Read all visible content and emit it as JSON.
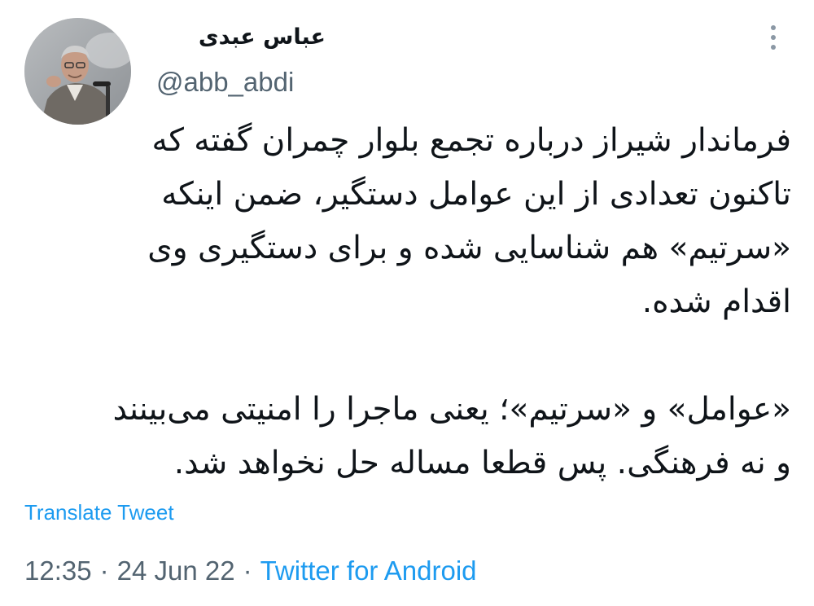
{
  "author": {
    "display_name": "عباس عبدی",
    "handle": "@abb_abdi"
  },
  "tweet": {
    "paragraph1": [
      "فرماندار شیراز درباره تجمع بلوار چمران گفته که",
      "تاکنون تعدادی از این عوامل دستگیر، ضمن اینکه",
      "«سرتیم» هم شناسایی شده و برای دستگیری وی",
      "اقدام شده."
    ],
    "paragraph2": [
      "«عوامل» و «سرتیم»؛ یعنی ماجرا را امنیتی می‌بینند",
      "و نه فرهنگی. پس قطعا مساله حل نخواهد شد."
    ]
  },
  "translate_label": "Translate Tweet",
  "meta": {
    "time": "12:35",
    "separator": "·",
    "date": "24 Jun 22",
    "source": "Twitter for Android"
  },
  "icons": {
    "more": "more-vertical-icon",
    "avatar": "profile-photo"
  },
  "colors": {
    "link": "#1d9bf0",
    "secondary": "#536471",
    "text": "#0f1419"
  }
}
